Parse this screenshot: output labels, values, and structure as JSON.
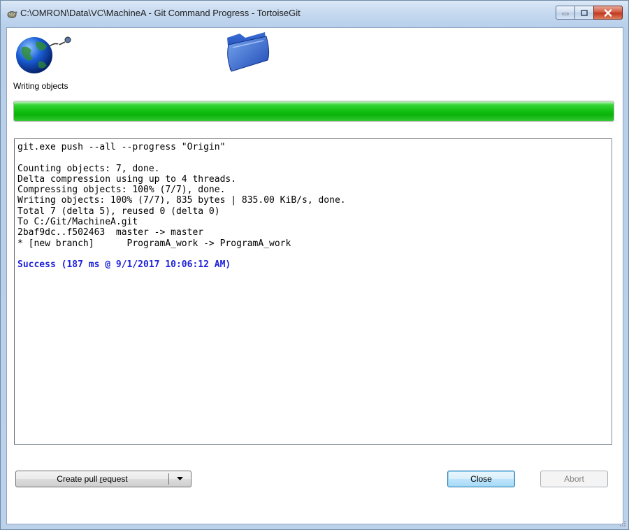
{
  "window": {
    "title": "C:\\OMRON\\Data\\VC\\MachineA - Git Command Progress - TortoiseGit"
  },
  "icons": {
    "app": "tortoisegit-icon",
    "source": "globe-network-icon",
    "target": "folder-icon"
  },
  "activity": {
    "label": "Writing objects",
    "progress_fraction": 1.0
  },
  "log": {
    "lines": [
      "git.exe push --all --progress \"Origin\"",
      "",
      "Counting objects: 7, done.",
      "Delta compression using up to 4 threads.",
      "Compressing objects: 100% (7/7), done.",
      "Writing objects: 100% (7/7), 835 bytes | 835.00 KiB/s, done.",
      "Total 7 (delta 5), reused 0 (delta 0)",
      "To C:/Git/MachineA.git",
      "2baf9dc..f502463  master -> master",
      "* [new branch]      ProgramA_work -> ProgramA_work",
      "",
      "Success (187 ms @ 9/1/2017 10:06:12 AM)"
    ],
    "success_color": "#1e22d9"
  },
  "buttons": {
    "pull_request_prefix": "Create pull ",
    "pull_request_underlined": "r",
    "pull_request_suffix": "equest",
    "close": "Close",
    "abort": "Abort"
  },
  "colors": {
    "progress": "#16c216",
    "titlebar": "#c4d8ef"
  }
}
